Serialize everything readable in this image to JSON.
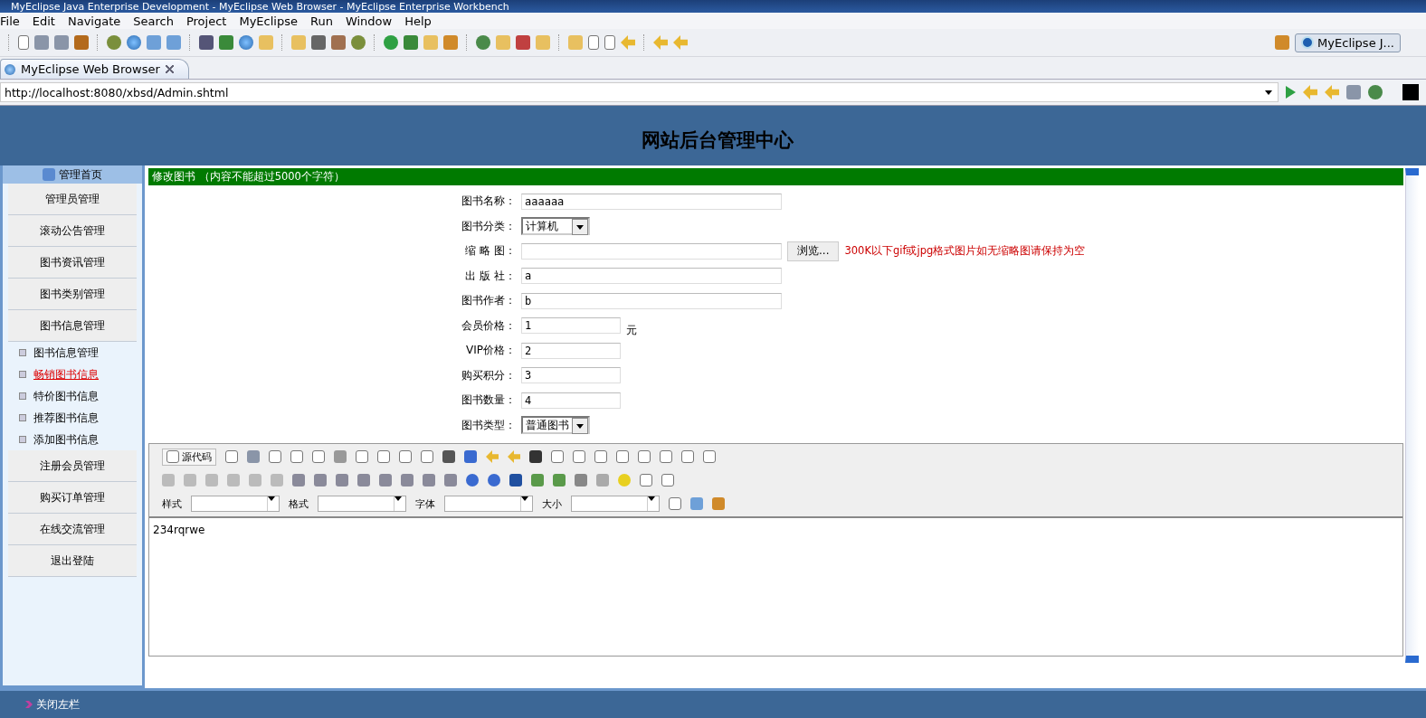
{
  "window": {
    "title": "MyEclipse Java Enterprise Development - MyEclipse Web Browser - MyEclipse Enterprise Workbench"
  },
  "menu": [
    "File",
    "Edit",
    "Navigate",
    "Search",
    "Project",
    "MyEclipse",
    "Run",
    "Window",
    "Help"
  ],
  "perspective": {
    "label": "MyEclipse J..."
  },
  "editor_tab": {
    "label": "MyEclipse Web Browser",
    "selected": true
  },
  "address": {
    "value": "http://localhost:8080/xbsd/Admin.shtml"
  },
  "page": {
    "title": "网站后台管理中心",
    "sidebar": {
      "home": "管理首页",
      "items": [
        {
          "label": "管理员管理",
          "kind": "section",
          "selected": false
        },
        {
          "label": "滚动公告管理",
          "kind": "section",
          "selected": false
        },
        {
          "label": "图书资讯管理",
          "kind": "section",
          "selected": false
        },
        {
          "label": "图书类别管理",
          "kind": "section",
          "selected": false
        },
        {
          "label": "图书信息管理",
          "kind": "section",
          "selected": false
        },
        {
          "label": "图书信息管理",
          "kind": "sub",
          "selected": false
        },
        {
          "label": "畅销图书信息",
          "kind": "sub",
          "selected": true
        },
        {
          "label": "特价图书信息",
          "kind": "sub",
          "selected": false
        },
        {
          "label": "推荐图书信息",
          "kind": "sub",
          "selected": false
        },
        {
          "label": "添加图书信息",
          "kind": "sub",
          "selected": false
        },
        {
          "label": "注册会员管理",
          "kind": "section",
          "selected": false
        },
        {
          "label": "购买订单管理",
          "kind": "section",
          "selected": false
        },
        {
          "label": "在线交流管理",
          "kind": "section",
          "selected": false
        },
        {
          "label": "退出登陆",
          "kind": "section",
          "selected": false
        }
      ]
    },
    "panel_title": "修改图书 （内容不能超过5000个字符）",
    "form": [
      {
        "label": "图书名称：",
        "kind": "text",
        "value": "aaaaaa"
      },
      {
        "label": "图书分类：",
        "kind": "select",
        "value": "计算机"
      },
      {
        "label": "缩 略 图：",
        "kind": "file",
        "button": "浏览...",
        "hint": "300K以下gif或jpg格式图片如无缩略图请保持为空"
      },
      {
        "label": "出 版 社：",
        "kind": "text",
        "value": "a"
      },
      {
        "label": "图书作者：",
        "kind": "text",
        "value": "b"
      },
      {
        "label": "会员价格：",
        "kind": "short",
        "value": "1",
        "unit": "元"
      },
      {
        "label": "VIP价格：",
        "kind": "short",
        "value": "2"
      },
      {
        "label": "购买积分：",
        "kind": "short",
        "value": "3"
      },
      {
        "label": "图书数量：",
        "kind": "short",
        "value": "4"
      },
      {
        "label": "图书类型：",
        "kind": "select",
        "value": "普通图书"
      }
    ],
    "editor": {
      "source_button": "源代码",
      "dropdowns": [
        "样式",
        "格式",
        "字体",
        "大小"
      ],
      "content": "234rqrwe"
    },
    "footer": {
      "close_left": "关闭左栏"
    }
  }
}
